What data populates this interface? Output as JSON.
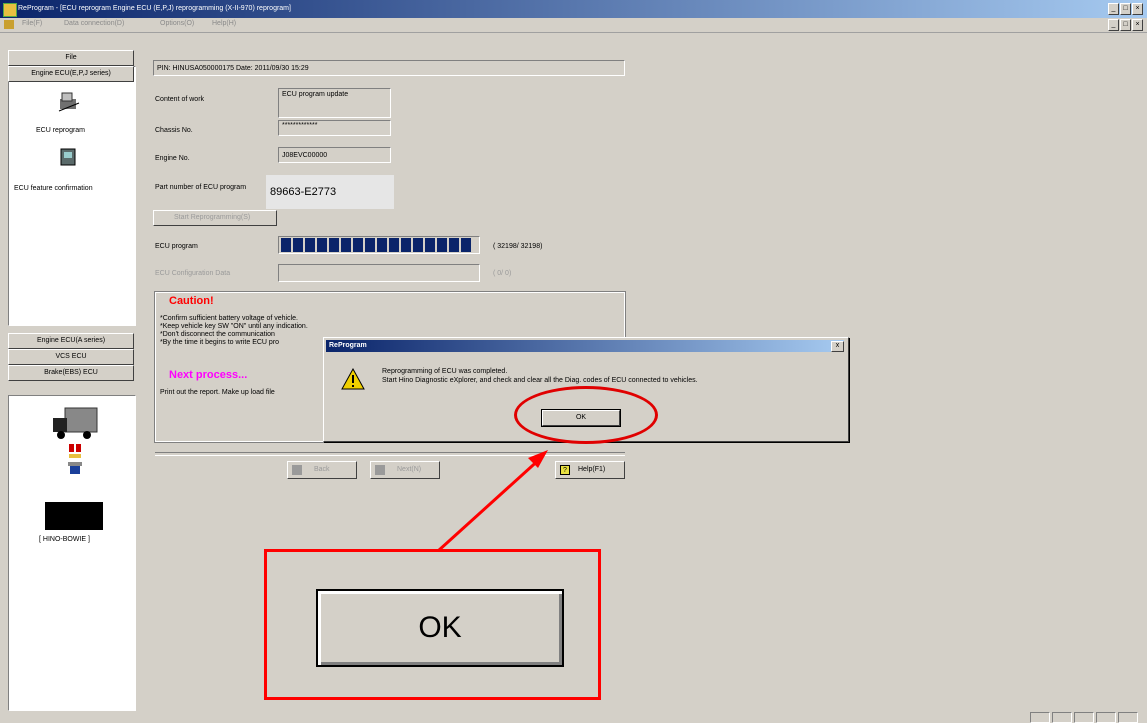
{
  "window": {
    "title": "ReProgram - [ECU reprogram Engine ECU (E,P,J) reprogramming (X-II-970) reprogram]",
    "menu": [
      "File(F)",
      "Data connection(D)",
      "Options(O)",
      "Help(H)"
    ]
  },
  "sidebar": {
    "file_tab": "File",
    "engine_tab": "Engine ECU(E,P,J series)",
    "items": [
      {
        "label": "ECU reprogram",
        "icon": "ecu-reprogram-icon"
      },
      {
        "label": "ECU feature confirmation",
        "icon": "ecu-feature-icon"
      }
    ],
    "lower_tabs": [
      "Engine ECU(A series)",
      "VCS ECU",
      "Brake(EBS) ECU"
    ],
    "device_label": "[ HINO-BOWIE ]"
  },
  "main": {
    "pin_line": "PIN: HINUSA050000175 Date: 2011/09/30 15:29",
    "content_of_work_label": "Content of work",
    "content_of_work_value": "ECU program update",
    "chassis_label": "Chassis No.",
    "chassis_value": "*************",
    "engine_label": "Engine No.",
    "engine_value": "J08EVC00000",
    "part_number_label": "Part number of ECU program",
    "part_number_value": "89663-E2773",
    "start_button": "Start Reprogramming(S)",
    "ecu_program_label": "ECU program",
    "ecu_program_count": "( 32198/  32198)",
    "ecu_program_progress": 1.0,
    "ecu_config_label": "ECU Configuration Data",
    "ecu_config_count": "(         0/         0)",
    "caution_title": "Caution!",
    "caution_lines": [
      "*Confirm sufficient battery voltage of vehicle.",
      "*Keep vehicle key SW \"ON\" until any indication.",
      "*Don't disconnect the communication",
      "*By the time it begins to write ECU pro"
    ],
    "next_title": "Next process...",
    "next_text": "Print out the report. Make up load file",
    "back_button": "Back",
    "next_button": "Next(N)",
    "help_button": "Help(F1)"
  },
  "dialog": {
    "title": "ReProgram",
    "close": "x",
    "line1": "Reprogramming of ECU was completed.",
    "line2": "Start Hino Diagnostic eXplorer, and check and clear all the Diag. codes of ECU connected to vehicles.",
    "ok_label": "OK"
  },
  "callout": {
    "ok_label": "OK"
  },
  "colors": {
    "caution": "#ff0000",
    "next_process": "#ff00ff",
    "progress": "#0a246a",
    "annotation": "#ff0000"
  }
}
